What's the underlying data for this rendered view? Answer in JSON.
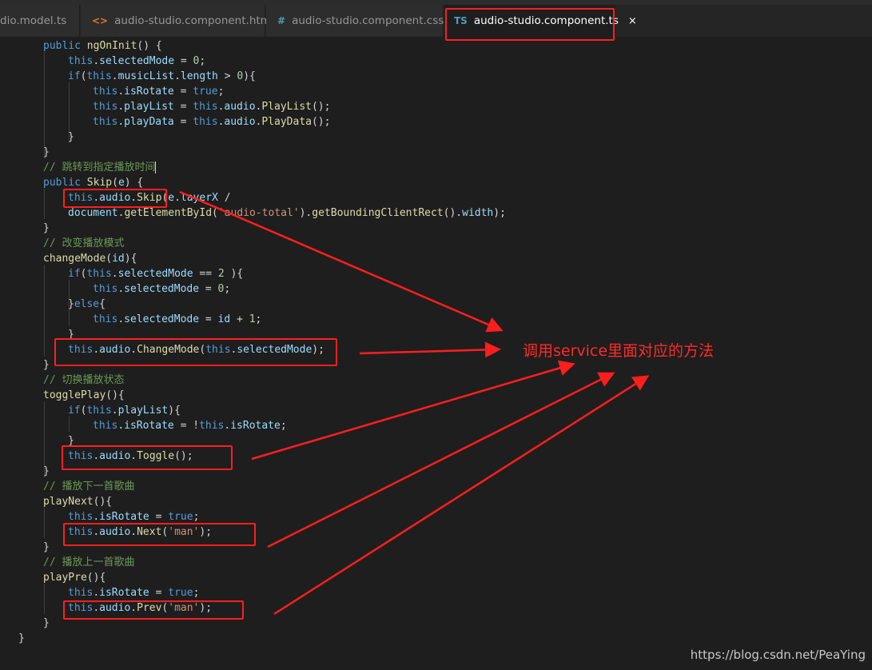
{
  "tabs": [
    {
      "icon": "",
      "label": "dio.model.ts"
    },
    {
      "icon": "<>",
      "label": "audio-studio.component.html"
    },
    {
      "icon": "#",
      "label": "audio-studio.component.css"
    },
    {
      "icon": "TS",
      "label": "audio-studio.component.ts",
      "close": "×"
    }
  ],
  "code": {
    "l01": {
      "a": "public ",
      "b": "ngOnInit",
      "c": "() {"
    },
    "l02": {
      "a": "this",
      "b": ".",
      "c": "selectedMode",
      "d": " = ",
      "e": "0",
      "f": ";"
    },
    "l03": {
      "a": "if",
      "b": "(",
      "c": "this",
      "d": ".",
      "e": "musicList",
      "f": ".",
      "g": "length",
      "h": " > ",
      "i": "0",
      "j": "){"
    },
    "l04": {
      "a": "this",
      "b": ".",
      "c": "isRotate",
      "d": " = ",
      "e": "true",
      "f": ";"
    },
    "l05": {
      "a": "this",
      "b": ".",
      "c": "playList",
      "d": " = ",
      "e": "this",
      "f": ".",
      "g": "audio",
      "h": ".",
      "i": "PlayList",
      "j": "();"
    },
    "l06": {
      "a": "this",
      "b": ".",
      "c": "playData",
      "d": " = ",
      "e": "this",
      "f": ".",
      "g": "audio",
      "h": ".",
      "i": "PlayData",
      "j": "();"
    },
    "l07": {
      "a": "}"
    },
    "l08": {
      "a": "}"
    },
    "l09": {
      "a": "// 跳转到指定播放时间"
    },
    "l10": {
      "a": "public ",
      "b": "Skip",
      "c": "(",
      "d": "e",
      "e": ") {"
    },
    "l11": {
      "a": "this",
      "b": ".",
      "c": "audio",
      "d": ".",
      "e": "Skip",
      "f": "(",
      "g": "e",
      "h": ".",
      "i": "layerX",
      "j": " /"
    },
    "l12": {
      "a": "document",
      "b": ".",
      "c": "getElementById",
      "d": "(",
      "e": "'audio-total'",
      "f": ").",
      "g": "getBoundingClientRect",
      "h": "().",
      "i": "width",
      "j": ");"
    },
    "l13": {
      "a": "}"
    },
    "l14": {
      "a": "// 改变播放模式"
    },
    "l15": {
      "a": "changeMode",
      "b": "(",
      "c": "id",
      "d": "){"
    },
    "l16": {
      "a": "if",
      "b": "(",
      "c": "this",
      "d": ".",
      "e": "selectedMode",
      "f": " == ",
      "g": "2",
      "h": " ){"
    },
    "l17": {
      "a": "this",
      "b": ".",
      "c": "selectedMode",
      "d": " = ",
      "e": "0",
      "f": ";"
    },
    "l18": {
      "a": "}",
      "b": "else",
      "c": "{"
    },
    "l19": {
      "a": "this",
      "b": ".",
      "c": "selectedMode",
      "d": " = ",
      "e": "id",
      "f": " + ",
      "g": "1",
      "h": ";"
    },
    "l20": {
      "a": "}"
    },
    "l21": {
      "a": "this",
      "b": ".",
      "c": "audio",
      "d": ".",
      "e": "ChangeMode",
      "f": "(",
      "g": "this",
      "h": ".",
      "i": "selectedMode",
      "j": ");"
    },
    "l22": {
      "a": "}"
    },
    "l23": {
      "a": "// 切换播放状态"
    },
    "l24": {
      "a": "togglePlay",
      "b": "(){"
    },
    "l25": {
      "a": "if",
      "b": "(",
      "c": "this",
      "d": ".",
      "e": "playList",
      "f": "){"
    },
    "l26": {
      "a": "this",
      "b": ".",
      "c": "isRotate",
      "d": " = !",
      "e": "this",
      "f": ".",
      "g": "isRotate",
      "h": ";"
    },
    "l27": {
      "a": "}"
    },
    "l28": {
      "a": "this",
      "b": ".",
      "c": "audio",
      "d": ".",
      "e": "Toggle",
      "f": "();"
    },
    "l29": {
      "a": "}"
    },
    "l30": {
      "a": "// 播放下一首歌曲"
    },
    "l31": {
      "a": "playNext",
      "b": "(){"
    },
    "l32": {
      "a": "this",
      "b": ".",
      "c": "isRotate",
      "d": " = ",
      "e": "true",
      "f": ";"
    },
    "l33": {
      "a": "this",
      "b": ".",
      "c": "audio",
      "d": ".",
      "e": "Next",
      "f": "(",
      "g": "'man'",
      "h": ");"
    },
    "l34": {
      "a": "}"
    },
    "l35": {
      "a": "// 播放上一首歌曲"
    },
    "l36": {
      "a": "playPre",
      "b": "(){"
    },
    "l37": {
      "a": "this",
      "b": ".",
      "c": "isRotate",
      "d": " = ",
      "e": "true",
      "f": ";"
    },
    "l38": {
      "a": "this",
      "b": ".",
      "c": "audio",
      "d": ".",
      "e": "Prev",
      "f": "(",
      "g": "'man'",
      "h": ");"
    },
    "l39": {
      "a": "}"
    },
    "l40": {
      "a": "}"
    }
  },
  "annotation": "调用service里面对应的方法",
  "watermark": "https://blog.csdn.net/PeaYing",
  "colors": {
    "highlight": "#ff1e1e",
    "background": "#1e1e1e"
  }
}
